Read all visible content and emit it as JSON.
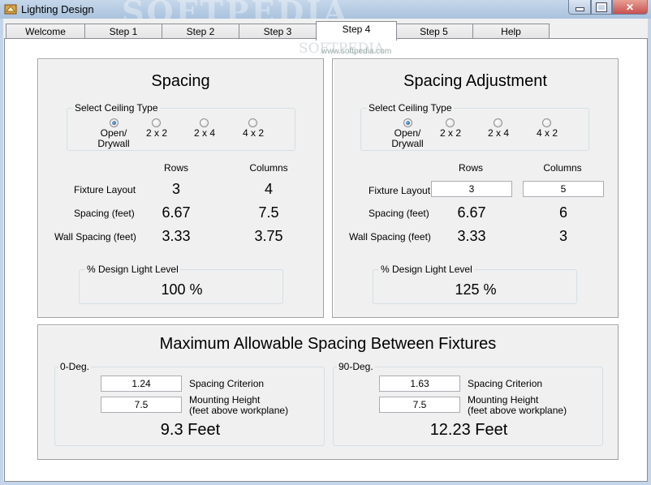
{
  "window": {
    "title": "Lighting Design",
    "watermark": "SOFTPEDIA",
    "close_glyph": "✕"
  },
  "tabs": [
    "Welcome",
    "Step 1",
    "Step 2",
    "Step 3",
    "Step 4",
    "Step 5",
    "Help"
  ],
  "active_tab": "Step 4",
  "page_watermark": {
    "logo": "SOFTPEDIA",
    "url": "www.softpedia.com"
  },
  "spacing": {
    "title": "Spacing",
    "ceiling_group_label": "Select Ceiling Type",
    "ceiling_options": [
      "Open/ Drywall",
      "2 x 2",
      "2 x 4",
      "4 x 2"
    ],
    "selected_option": "Open/ Drywall",
    "col_rows": "Rows",
    "col_columns": "Columns",
    "row_labels": [
      "Fixture Layout",
      "Spacing (feet)",
      "Wall Spacing (feet)"
    ],
    "fixture_rows": "3",
    "fixture_columns": "4",
    "spacing_rows": "6.67",
    "spacing_columns": "7.5",
    "wall_rows": "3.33",
    "wall_columns": "3.75",
    "light_level_label": "% Design Light Level",
    "light_level": "100 %"
  },
  "adjustment": {
    "title": "Spacing Adjustment",
    "ceiling_group_label": "Select Ceiling Type",
    "ceiling_options": [
      "Open/ Drywall",
      "2 x 2",
      "2 x 4",
      "4 x 2"
    ],
    "selected_option": "Open/ Drywall",
    "col_rows": "Rows",
    "col_columns": "Columns",
    "row_labels": [
      "Fixture Layout",
      "Spacing (feet)",
      "Wall Spacing (feet)"
    ],
    "fixture_rows_value": "3",
    "fixture_columns_value": "5",
    "spacing_rows": "6.67",
    "spacing_columns": "6",
    "wall_rows": "3.33",
    "wall_columns": "3",
    "light_level_label": "% Design Light Level",
    "light_level": "125 %"
  },
  "max_spacing": {
    "title": "Maximum Allowable Spacing Between Fixtures",
    "zero_deg": {
      "label": "0-Deg.",
      "spacing_criterion_value": "1.24",
      "spacing_criterion_label": "Spacing Criterion",
      "mounting_height_value": "7.5",
      "mounting_height_label": "Mounting Height",
      "mounting_height_sublabel": "(feet above workplane)",
      "result": "9.3 Feet"
    },
    "ninety_deg": {
      "label": "90-Deg.",
      "spacing_criterion_value": "1.63",
      "spacing_criterion_label": "Spacing Criterion",
      "mounting_height_value": "7.5",
      "mounting_height_label": "Mounting Height",
      "mounting_height_sublabel": "(feet above workplane)",
      "result": "12.23 Feet"
    }
  }
}
